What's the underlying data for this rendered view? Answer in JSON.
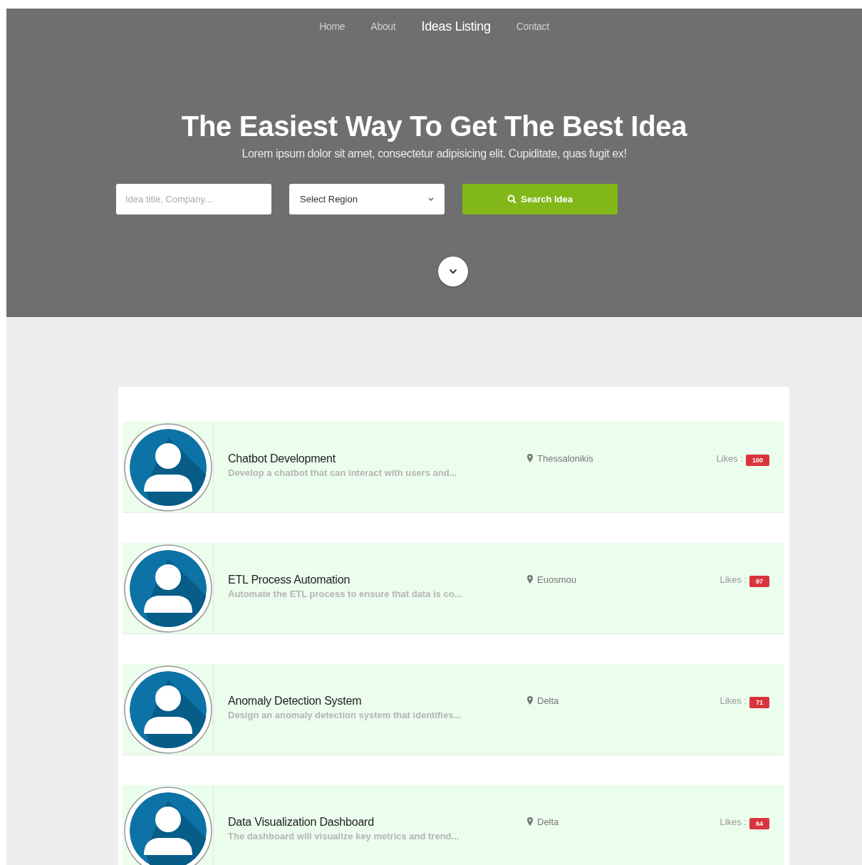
{
  "nav": [
    {
      "label": "Home",
      "selected": false
    },
    {
      "label": "About",
      "selected": false
    },
    {
      "label": "Ideas Listing",
      "selected": true
    },
    {
      "label": "Contact",
      "selected": false
    }
  ],
  "hero": {
    "title": "The Easiest Way To Get The Best Idea",
    "subtitle": "Lorem ipsum dolor sit amet, consectetur adipisicing elit. Cupiditate, quas fugit ex!",
    "search": {
      "placeholder": "Idea title, Company..."
    },
    "region": {
      "value": "Select Region"
    },
    "button": "Search Idea"
  },
  "ideas": [
    {
      "title": "Chatbot Development",
      "description": "Develop a chatbot that can interact with users and...",
      "location": "Thessalonikis",
      "likes_label": "Likes :",
      "likes": "100"
    },
    {
      "title": "ETL Process Automation",
      "description": "Automate the ETL process to ensure that data is co...",
      "location": "Euosmou",
      "likes_label": "Likes :",
      "likes": "97"
    },
    {
      "title": "Anomaly Detection System",
      "description": "Design an anomaly detection system that identifies...",
      "location": "Delta",
      "likes_label": "Likes :",
      "likes": "71"
    },
    {
      "title": "Data Visualization Dashboard",
      "description": "The dashboard will visualize key metrics and trend...",
      "location": "Delta",
      "likes_label": "Likes :",
      "likes": "64"
    }
  ]
}
